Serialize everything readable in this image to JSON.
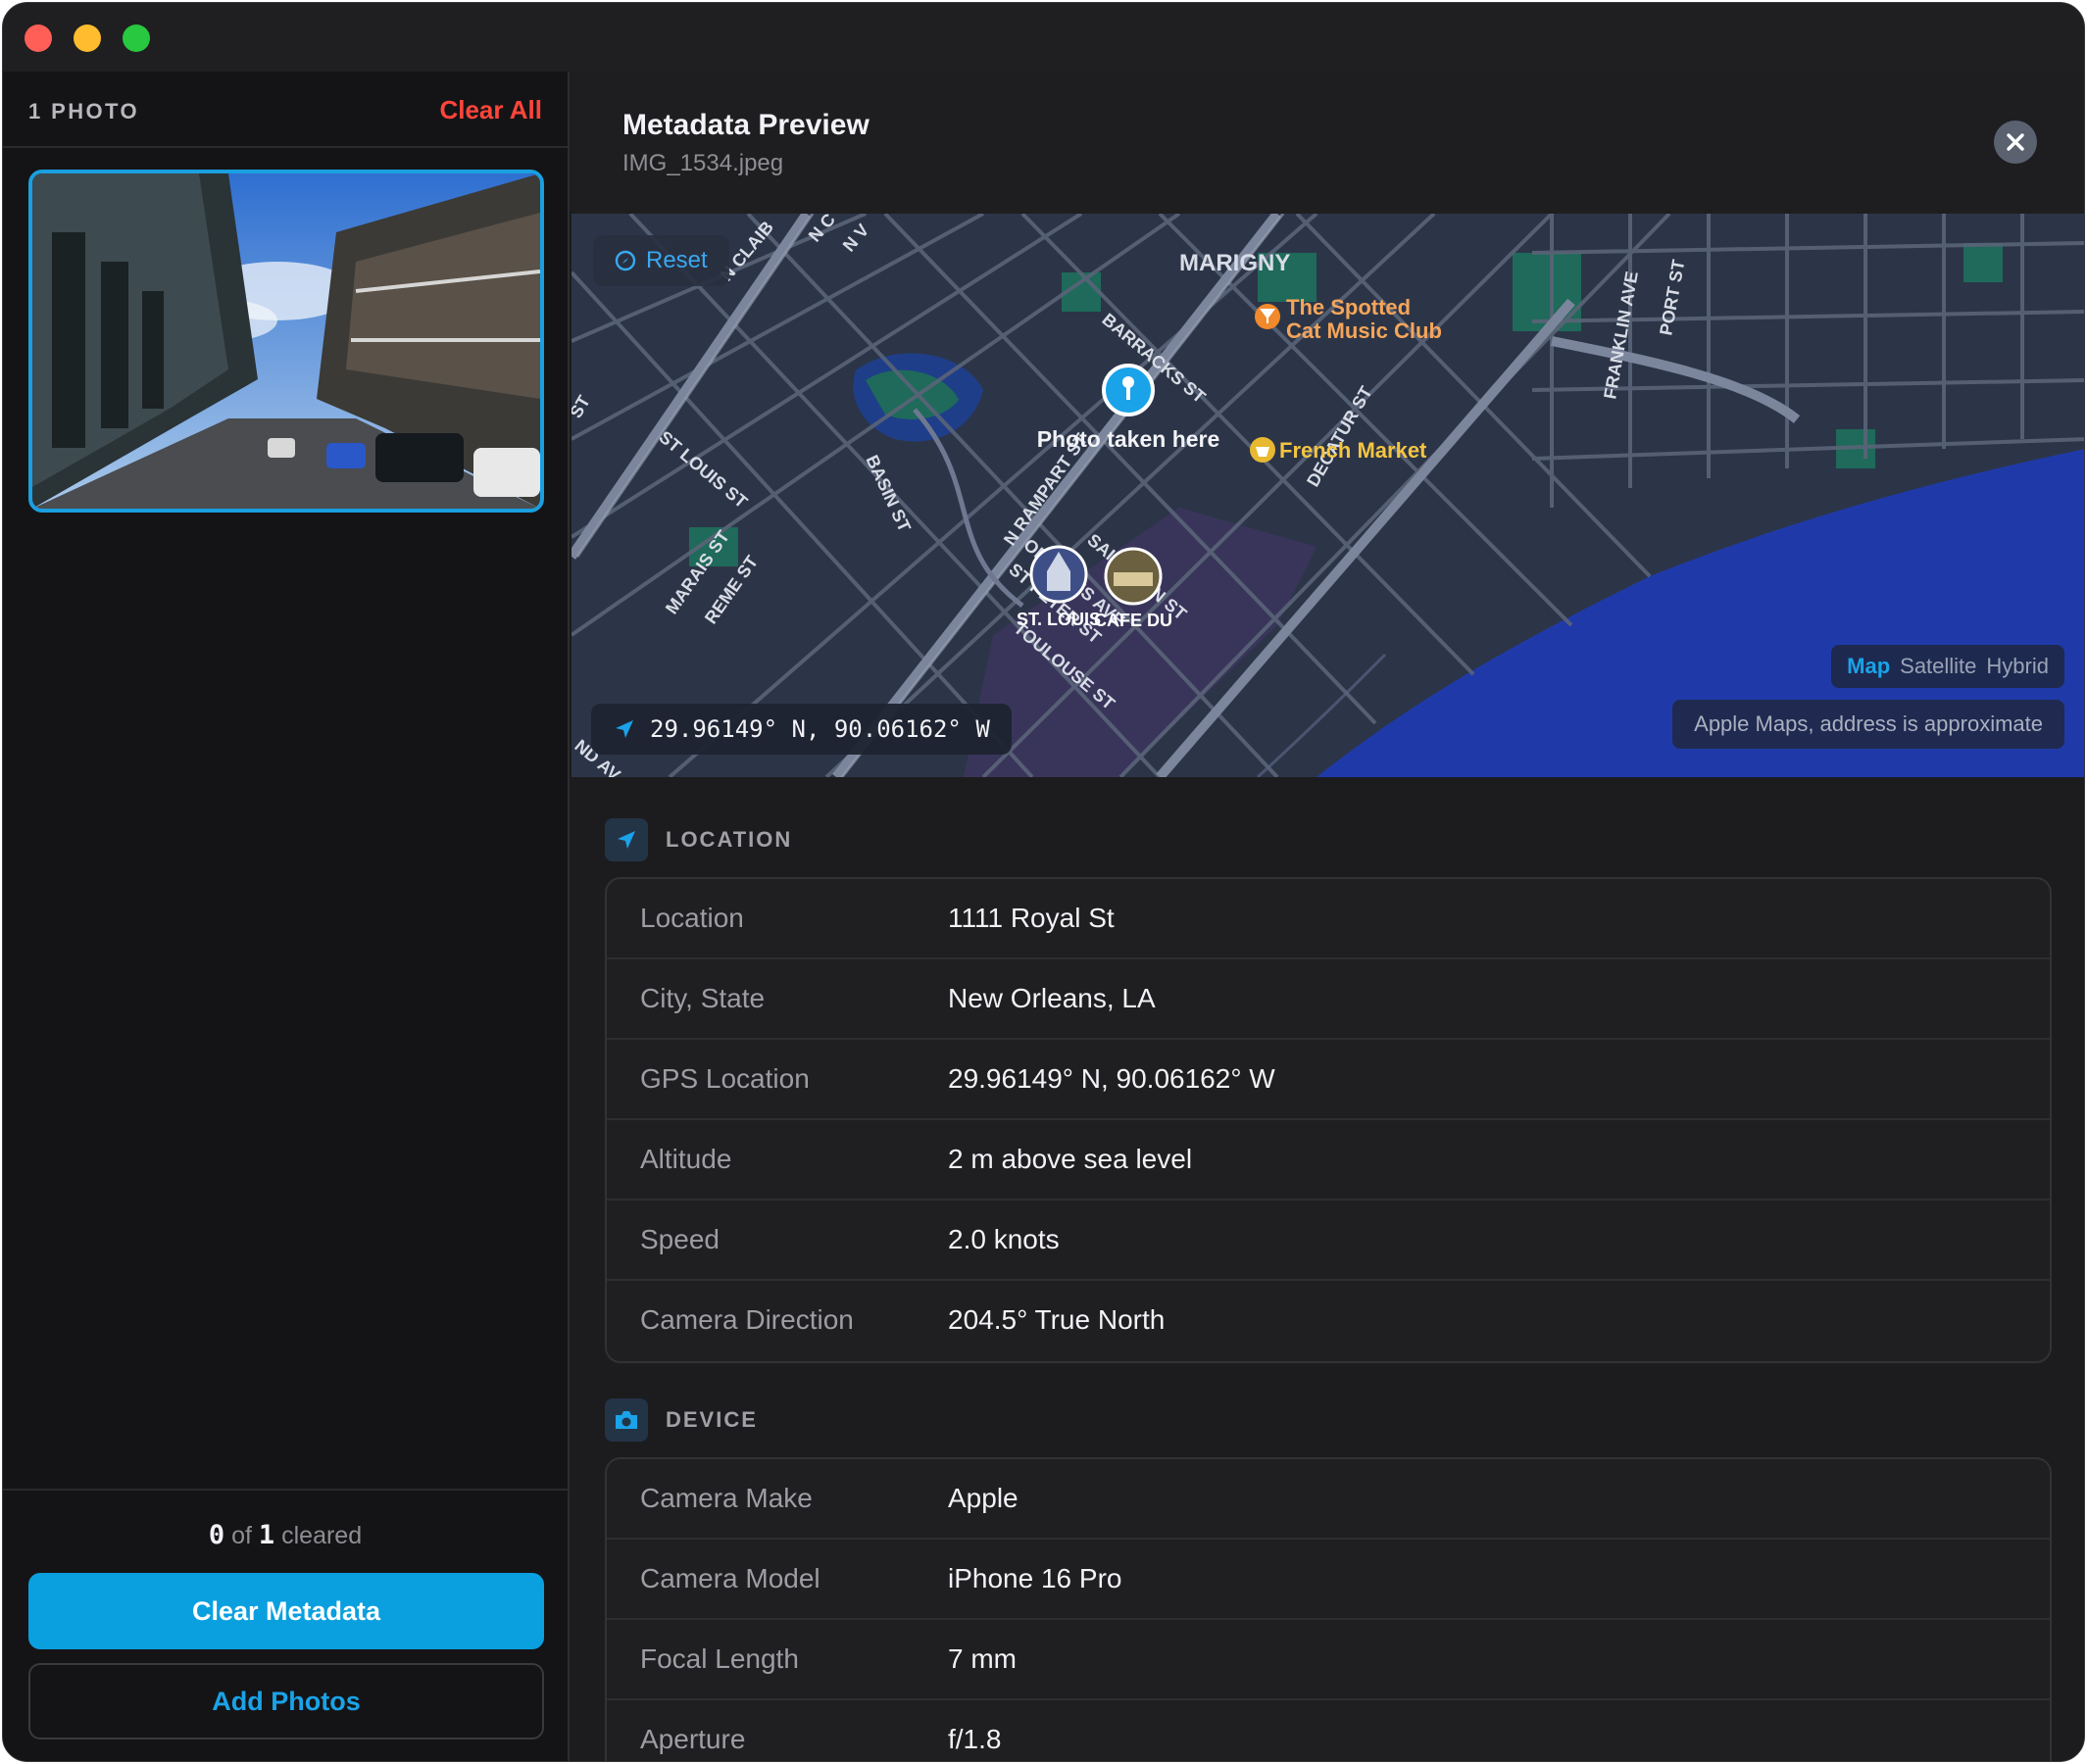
{
  "sidebar": {
    "photo_count": "1 PHOTO",
    "clear_all": "Clear All",
    "cleared_count": "0",
    "cleared_of": "of",
    "cleared_total": "1",
    "cleared_word": "cleared",
    "clear_metadata": "Clear Metadata",
    "add_photos": "Add Photos"
  },
  "header": {
    "title": "Metadata Preview",
    "filename": "IMG_1534.jpeg"
  },
  "map": {
    "reset_label": "Reset",
    "neighborhood": "MARIGNY",
    "pin_label": "Photo taken here",
    "poi_1_line1": "The Spotted",
    "poi_1_line2": "Cat Music Club",
    "poi_2": "French Market",
    "poi_3": "ST. LOUIS",
    "poi_4": "CAFE DU",
    "streets": {
      "barracks": "BARRACKS ST",
      "st_louis": "ST LOUIS ST",
      "basin": "BASIN ST",
      "n_rampart": "N RAMPART ST",
      "orleans": "ORLEANS AVE",
      "st_peter": "ST PETER ST",
      "saint_ann": "SAINT ANN ST",
      "toulouse": "TOULOUSE ST",
      "decatur": "DECATUR ST",
      "marais": "MARAIS ST",
      "treme": "REME ST",
      "franklin": "FRANKLIN AVE",
      "port": "PORT ST",
      "n_claiborne": "N CLAIB",
      "n_v": "N V",
      "n_c": "N C",
      "st": "ST",
      "nd_av": "ND AV"
    },
    "coords": "29.96149° N, 90.06162° W",
    "map_types": [
      "Map",
      "Satellite",
      "Hybrid"
    ],
    "map_type_selected": "Map",
    "attribution": "Apple Maps, address is approximate",
    "colors": {
      "water": "#1f3aa8",
      "land": "#2c3547",
      "park": "#1f6a5a",
      "road": "#5a6478"
    }
  },
  "location": {
    "section_label": "LOCATION",
    "rows": [
      {
        "key": "Location",
        "value": "1111 Royal St"
      },
      {
        "key": "City, State",
        "value": "New Orleans, LA"
      },
      {
        "key": "GPS Location",
        "value": "29.96149° N, 90.06162° W"
      },
      {
        "key": "Altitude",
        "value": "2 m above sea level"
      },
      {
        "key": "Speed",
        "value": "2.0 knots"
      },
      {
        "key": "Camera Direction",
        "value": "204.5° True North"
      }
    ]
  },
  "device": {
    "section_label": "DEVICE",
    "rows": [
      {
        "key": "Camera Make",
        "value": "Apple"
      },
      {
        "key": "Camera Model",
        "value": "iPhone 16 Pro"
      },
      {
        "key": "Focal Length",
        "value": "7 mm"
      },
      {
        "key": "Aperture",
        "value": "f/1.8"
      }
    ]
  },
  "colors": {
    "accent": "#0aa0df",
    "danger": "#ff453a",
    "background": "#1c1c1e",
    "sidebar": "#141416"
  },
  "icons": {
    "reset": "compass-icon",
    "coords": "location-arrow-icon",
    "location_section": "location-arrow-icon",
    "device_section": "camera-icon",
    "close": "close-icon"
  }
}
